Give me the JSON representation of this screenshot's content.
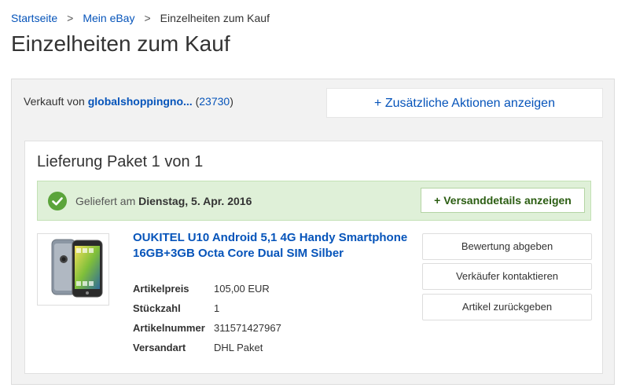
{
  "breadcrumb": {
    "home": "Startseite",
    "my_ebay": "Mein eBay",
    "current": "Einzelheiten zum Kauf",
    "separator": ">"
  },
  "page_title": "Einzelheiten zum Kauf",
  "seller": {
    "prefix": "Verkauft von",
    "name": "globalshoppingno...",
    "open_paren": "(",
    "feedback_score": "23730",
    "close_paren": ")"
  },
  "more_actions_label": "+ Zusätzliche Aktionen anzeigen",
  "shipment": {
    "title": "Lieferung Paket 1 von 1",
    "status_prefix": "Geliefert am",
    "status_date": "Dienstag, 5. Apr. 2016",
    "ship_details_label": "+ Versanddetails anzeigen",
    "status_color": "#5ba43b"
  },
  "item": {
    "title": "OUKITEL U10 Android 5,1 4G Handy Smartphone 16GB+3GB Octa Core Dual SIM Silber",
    "specs": [
      {
        "label": "Artikelpreis",
        "value": "105,00 EUR"
      },
      {
        "label": "Stückzahl",
        "value": "1"
      },
      {
        "label": "Artikelnummer",
        "value": "311571427967"
      },
      {
        "label": "Versandart",
        "value": "DHL Paket"
      }
    ]
  },
  "actions": {
    "feedback": "Bewertung abgeben",
    "contact_seller": "Verkäufer kontaktieren",
    "return_item": "Artikel zurückgeben"
  },
  "colors": {
    "link": "#0654ba",
    "success_bg": "#dff0d8"
  }
}
